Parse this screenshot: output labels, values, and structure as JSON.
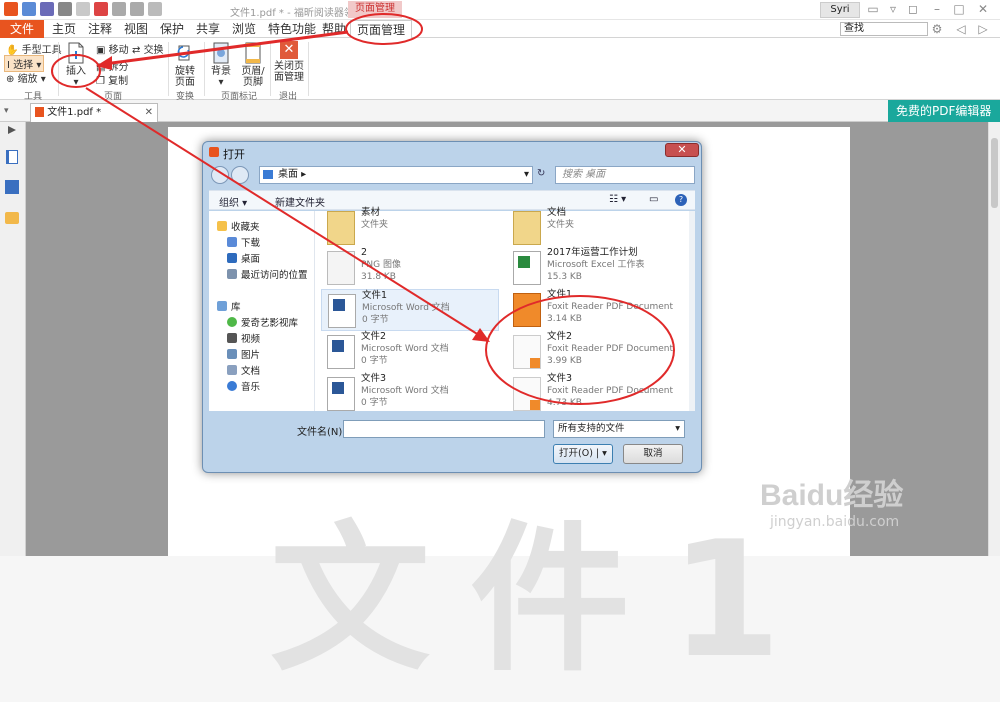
{
  "window": {
    "title": "文件1.pdf * - 福昕阅读器领鲜版",
    "context_tab": "页面管理",
    "user": "Syri"
  },
  "menu": {
    "file": "文件",
    "tabs": [
      "主页",
      "注释",
      "视图",
      "保护",
      "共享",
      "浏览",
      "特色功能",
      "帮助"
    ],
    "active_tab": "页面管理",
    "search_placeholder": "查找"
  },
  "ribbon": {
    "tools": {
      "hand": "手型工具",
      "select": "选择",
      "zoom": "缩放",
      "label": "工具"
    },
    "pages": {
      "insert": "插入",
      "move": "移动",
      "swap": "交换",
      "split": "拆分",
      "copy": "复制",
      "label": "页面"
    },
    "transform": {
      "rotate": "旋转页面",
      "label": "变换"
    },
    "marks": {
      "background": "背景",
      "header_footer": "页眉/页脚",
      "label": "页面标记"
    },
    "exit": {
      "close": "关闭页面管理",
      "label": "退出"
    }
  },
  "doc_tab": "文件1.pdf *",
  "promo": "免费的PDF编辑器",
  "page_text": "文件1",
  "dialog": {
    "title": "打开",
    "address": "桌面",
    "search_placeholder": "搜索 桌面",
    "organize": "组织 ▾",
    "new_folder": "新建文件夹",
    "nav": {
      "favorites": "收藏夹",
      "items_fav": [
        "下载",
        "桌面",
        "最近访问的位置"
      ],
      "library": "库",
      "items_lib": [
        "爱奇艺影视库",
        "视频",
        "图片",
        "文档",
        "音乐"
      ]
    },
    "files": [
      {
        "name": "素材",
        "type": "文件夹",
        "size": "",
        "icon": "folder"
      },
      {
        "name": "文档",
        "type": "文件夹",
        "size": "",
        "icon": "folder"
      },
      {
        "name": "2",
        "type": "PNG 图像",
        "size": "31.8 KB",
        "icon": "png"
      },
      {
        "name": "2017年运营工作计划",
        "type": "Microsoft Excel 工作表",
        "size": "15.3 KB",
        "icon": "excel"
      },
      {
        "name": "文件1",
        "type": "Microsoft Word 文档",
        "size": "0 字节",
        "icon": "word"
      },
      {
        "name": "文件1",
        "type": "Foxit Reader PDF Document",
        "size": "3.14 KB",
        "icon": "pdf"
      },
      {
        "name": "文件2",
        "type": "Microsoft Word 文档",
        "size": "0 字节",
        "icon": "word"
      },
      {
        "name": "文件2",
        "type": "Foxit Reader PDF Document",
        "size": "3.99 KB",
        "icon": "foxit"
      },
      {
        "name": "文件3",
        "type": "Microsoft Word 文档",
        "size": "0 字节",
        "icon": "word"
      },
      {
        "name": "文件3",
        "type": "Foxit Reader PDF Document",
        "size": "4.73 KB",
        "icon": "foxit"
      }
    ],
    "filename_label": "文件名(N):",
    "filename_value": "",
    "filetype": "所有支持的文件",
    "open": "打开(O)",
    "cancel": "取消"
  },
  "watermark": {
    "brand": "Baidu经验",
    "url": "jingyan.baidu.com"
  },
  "colors": {
    "accent": "#e8541f",
    "annotation": "#e02a2a",
    "promo": "#1aa89c"
  }
}
